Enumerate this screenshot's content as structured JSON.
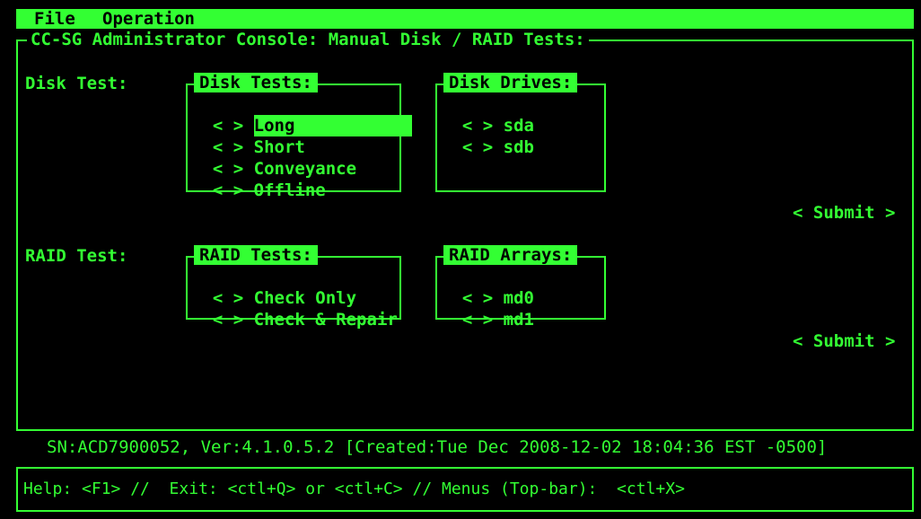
{
  "menubar": {
    "file": "File",
    "operation": "Operation"
  },
  "console_title": "CC-SG Administrator Console: Manual Disk / RAID Tests:",
  "disk": {
    "label": "Disk Test:",
    "tests_title": "Disk Tests:",
    "tests": [
      {
        "marker": "< >",
        "label": "Long",
        "selected": true
      },
      {
        "marker": "< >",
        "label": "Short"
      },
      {
        "marker": "< >",
        "label": "Conveyance"
      },
      {
        "marker": "< >",
        "label": "Offline"
      }
    ],
    "drives_title": "Disk Drives:",
    "drives": [
      {
        "marker": "< >",
        "label": "sda"
      },
      {
        "marker": "< >",
        "label": "sdb"
      }
    ],
    "submit": "< Submit >"
  },
  "raid": {
    "label": "RAID Test:",
    "tests_title": "RAID Tests:",
    "tests": [
      {
        "marker": "< >",
        "label": "Check Only"
      },
      {
        "marker": "< >",
        "label": "Check & Repair"
      }
    ],
    "arrays_title": "RAID Arrays:",
    "arrays": [
      {
        "marker": "< >",
        "label": "md0"
      },
      {
        "marker": "< >",
        "label": "md1"
      }
    ],
    "submit": "< Submit >"
  },
  "status": "SN:ACD7900052, Ver:4.1.0.5.2 [Created:Tue Dec 2008-12-02 18:04:36 EST -0500]",
  "help": "Help: <F1> //  Exit: <ctl+Q> or <ctl+C> // Menus (Top-bar):  <ctl+X>",
  "colors": {
    "accent": "#33ff33",
    "background": "#000000"
  }
}
